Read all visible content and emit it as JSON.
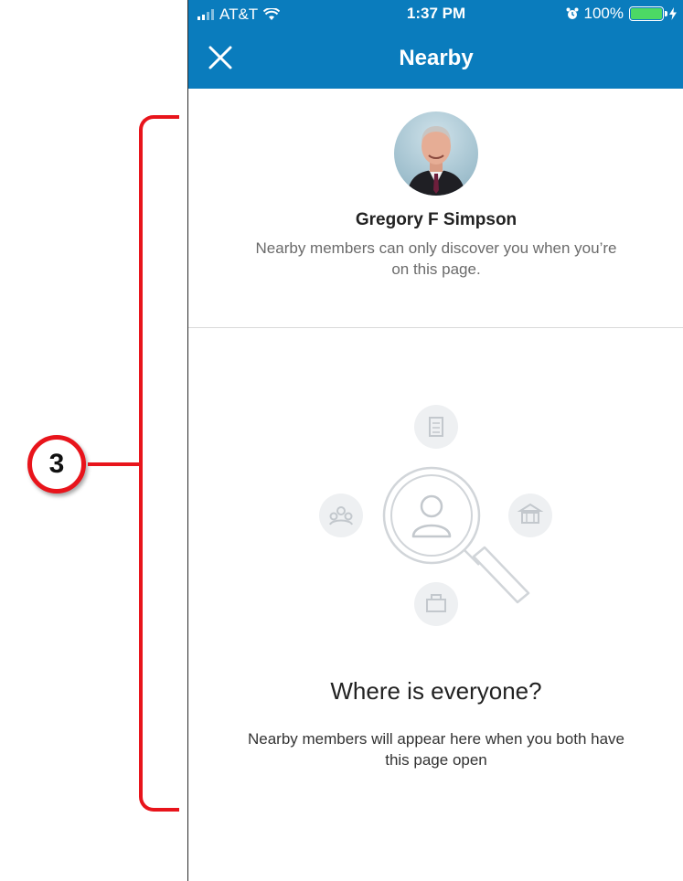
{
  "annotation": {
    "number": "3"
  },
  "status_bar": {
    "carrier": "AT&T",
    "time": "1:37 PM",
    "battery": "100%"
  },
  "nav": {
    "title": "Nearby"
  },
  "profile": {
    "name": "Gregory F Simpson",
    "description": "Nearby members can only discover you when you’re on this page."
  },
  "empty_state": {
    "title": "Where is everyone?",
    "subtitle": "Nearby members will appear here when you both have this page open"
  },
  "colors": {
    "brand_blue": "#0a7cbd",
    "annotation_red": "#e8141b",
    "battery_green": "#4cd964"
  }
}
